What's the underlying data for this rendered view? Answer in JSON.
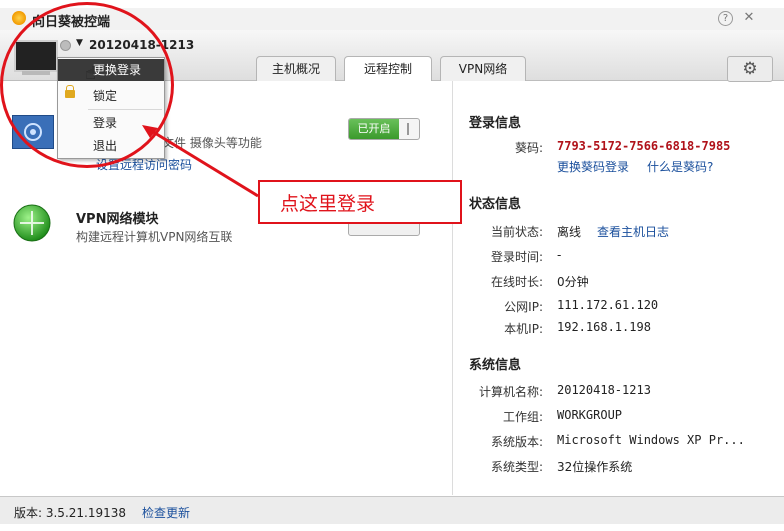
{
  "window": {
    "title": "向日葵被控端",
    "help_icon": "?",
    "close_icon": "✕"
  },
  "header": {
    "hostname": "20120418-1213",
    "tabs": [
      {
        "label": "主机概况"
      },
      {
        "label": "远程控制"
      },
      {
        "label": "VPN网络"
      }
    ]
  },
  "menu": {
    "items": [
      {
        "label": "更换登录"
      },
      {
        "label": "锁定"
      },
      {
        "label": "登录"
      },
      {
        "label": "退出"
      }
    ]
  },
  "modules": {
    "remote": {
      "desc_partial": "文件  摄像头等功能",
      "toggle_label": "已开启",
      "link": "设置远程访问密码"
    },
    "vpn": {
      "title": "VPN网络模块",
      "desc": "构建远程计算机VPN网络互联"
    }
  },
  "login_info": {
    "heading": "登录信息",
    "code_label": "葵码:",
    "code_value": "7793-5172-7566-6818-7985",
    "change_link": "更换葵码登录",
    "what_link": "什么是葵码?"
  },
  "status_info": {
    "heading": "状态信息",
    "rows": [
      {
        "label": "当前状态:",
        "value": "离线",
        "link": "查看主机日志"
      },
      {
        "label": "登录时间:",
        "value": "-"
      },
      {
        "label": "在线时长:",
        "value": "0分钟"
      },
      {
        "label": "公网IP:",
        "value": "111.172.61.120"
      },
      {
        "label": "本机IP:",
        "value": "192.168.1.198"
      }
    ]
  },
  "system_info": {
    "heading": "系统信息",
    "rows": [
      {
        "label": "计算机名称:",
        "value": "20120418-1213"
      },
      {
        "label": "工作组:",
        "value": "WORKGROUP"
      },
      {
        "label": "系统版本:",
        "value": "Microsoft Windows XP Pr..."
      },
      {
        "label": "系统类型:",
        "value": "32位操作系统"
      }
    ]
  },
  "footer": {
    "version": "版本: 3.5.21.19138",
    "update_link": "检查更新"
  },
  "annotation": {
    "callout": "点这里登录",
    "color": "#e0131b"
  },
  "colors": {
    "accent": "#e0131b",
    "link": "#1a4f9c",
    "toggle_on": "#3b9a2c",
    "code": "#b0121a"
  }
}
